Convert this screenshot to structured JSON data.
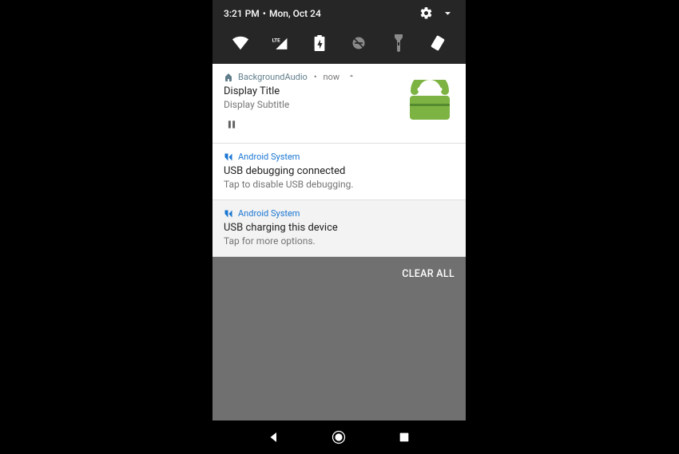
{
  "status": {
    "time": "3:21 PM",
    "separator": "•",
    "date": "Mon, Oct 24"
  },
  "quick_settings": {
    "icons": [
      "wifi",
      "lte-signal",
      "battery-charging",
      "dnd-off",
      "flashlight",
      "auto-rotate"
    ]
  },
  "notifications": [
    {
      "app_name": "BackgroundAudio",
      "when": "now",
      "title": "Display Title",
      "subtitle": "Display Subtitle",
      "media": true,
      "action_icon": "pause",
      "header_color": "#607d8b"
    },
    {
      "app_name": "Android System",
      "title": "USB debugging connected",
      "subtitle": "Tap to disable USB debugging.",
      "header_color": "#1976d2"
    },
    {
      "app_name": "Android System",
      "title": "USB charging this device",
      "subtitle": "Tap for more options.",
      "header_color": "#1976d2",
      "grey_bg": true
    }
  ],
  "shade": {
    "clear_all_label": "CLEAR ALL"
  },
  "navbar": {
    "buttons": [
      "back",
      "home",
      "recents"
    ]
  }
}
